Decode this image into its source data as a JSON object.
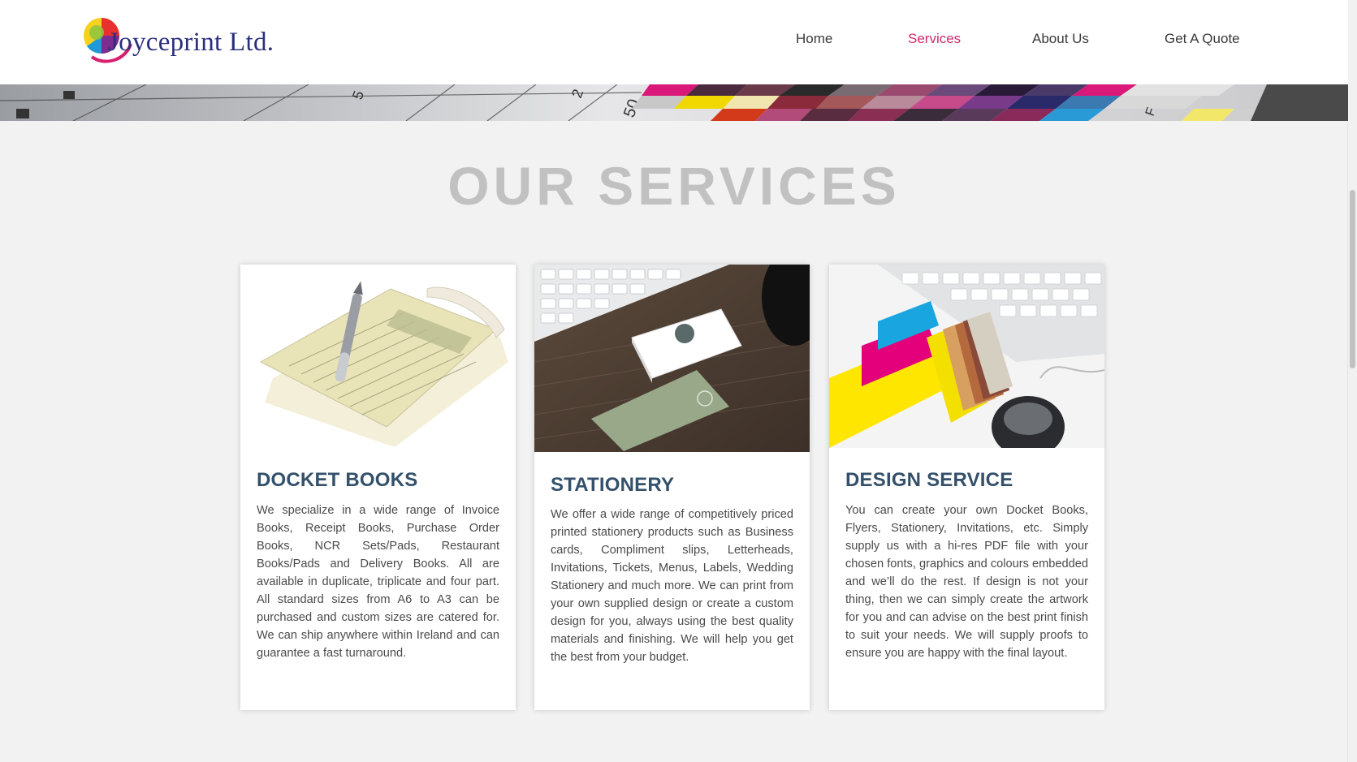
{
  "header": {
    "brand": "Joyceprint Ltd.",
    "nav": [
      {
        "label": "Home",
        "active": false
      },
      {
        "label": "Services",
        "active": true
      },
      {
        "label": "About Us",
        "active": false
      },
      {
        "label": "Get A Quote",
        "active": false
      }
    ]
  },
  "hero": {
    "visible_marks": [
      "5",
      "2",
      "50",
      "F"
    ]
  },
  "services": {
    "title": "OUR SERVICES",
    "cards": [
      {
        "title": "DOCKET BOOKS",
        "image": "docket-book-photo",
        "body": "We specialize in a wide range of Invoice Books, Receipt Books, Purchase Order Books, NCR Sets/Pads, Restaurant Books/Pads and Delivery Books. All are available in duplicate, triplicate and four part. All standard sizes from A6 to A3 can be purchased and custom sizes are catered for. We can ship anywhere within Ireland and can guarantee a fast turnaround."
      },
      {
        "title": "STATIONERY",
        "image": "business-cards-photo",
        "body": "We offer a wide range of competitively priced printed stationery products such as Business cards, Compliment slips, Letterheads, Invitations, Tickets, Menus, Labels, Wedding Stationery and much more. We can print from your own supplied design or create a custom design for you, always using the best quality materials and finishing. We will help you get the best from your budget."
      },
      {
        "title": "DESIGN SERVICE",
        "image": "colour-swatch-photo",
        "body": "You can create your own Docket Books, Flyers, Stationery, Invitations, etc. Simply supply us with a hi-res PDF file with your chosen fonts, graphics and colours embedded and we’ll do the rest. If design is not your thing, then we can simply create the artwork for you and can advise on the best print finish to suit your needs. We will supply proofs to ensure you are happy with the final layout."
      }
    ]
  },
  "colors": {
    "nav_active": "#cf2a6e",
    "heading": "#34506a",
    "title_grey": "#c1c1c1",
    "brand_navy": "#2b2f7c"
  }
}
